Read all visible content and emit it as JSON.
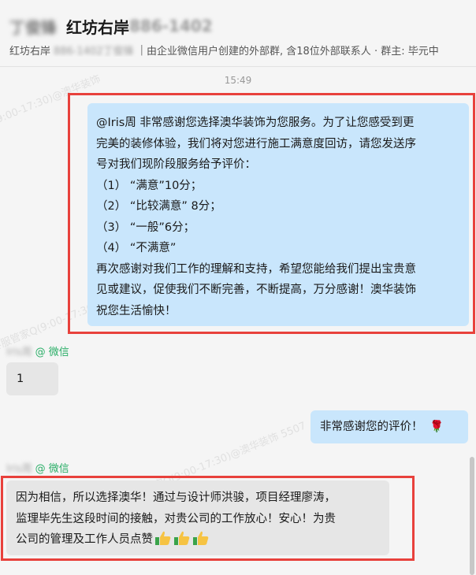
{
  "header": {
    "contact_blurred": "丁俊锋",
    "title": "红坊右岸",
    "title_suffix_blurred": "886-1402",
    "subtitle_prefix": "红坊右岸",
    "subtitle_blurred": "886-1402丁俊锋",
    "subtitle_text": "由企业微信用户创建的外部群, 含18位外部联系人 · 群主: 毕元中"
  },
  "timestamp": "15:49",
  "watermarks": [
    "9:00-17:30)@澳华装饰",
    "客服管家Q(9:00-17:30)@澳华装饰 5507",
    "客服管家Q(9:00-17:30)@澳华装饰 5507"
  ],
  "messages": {
    "survey": {
      "lines": [
        "@Iris周 非常感谢您选择澳华装饰为您服务。为了让您感受到更",
        "完美的装修体验，我们将对您进行施工满意度回访，请您发送序",
        "号对我们现阶段服务给予评价：",
        "（1） “满意”10分；",
        "（2） “比较满意” 8分；",
        "（3） “一般”6分；",
        "（4） “不满意”",
        "再次感谢对我们工作的理解和支持，希望您能给我们提出宝贵意",
        "见或建议，促使我们不断完善，不断提高，万分感谢！澳华装饰",
        "祝您生活愉快！"
      ]
    },
    "reply1": {
      "sender_blurred": "Iris周",
      "source": "@ 微信",
      "text": "1"
    },
    "thanks": {
      "text": "非常感谢您的评价！",
      "emoji": "🌹"
    },
    "reply2": {
      "sender_blurred": "Iris周",
      "source": "@ 微信",
      "lines": [
        "因为相信，所以选择澳华！通过与设计师洪骏，项目经理廖涛，",
        "监理毕先生这段时间的接触，对贵公司的工作放心！安心！为贵",
        "公司的管理及工作人员点赞"
      ]
    }
  },
  "colors": {
    "bubble_self": "#c9e6fc",
    "bubble_other": "#e6e6e6",
    "highlight": "#e8413c",
    "wechat_green": "#2aae67"
  }
}
